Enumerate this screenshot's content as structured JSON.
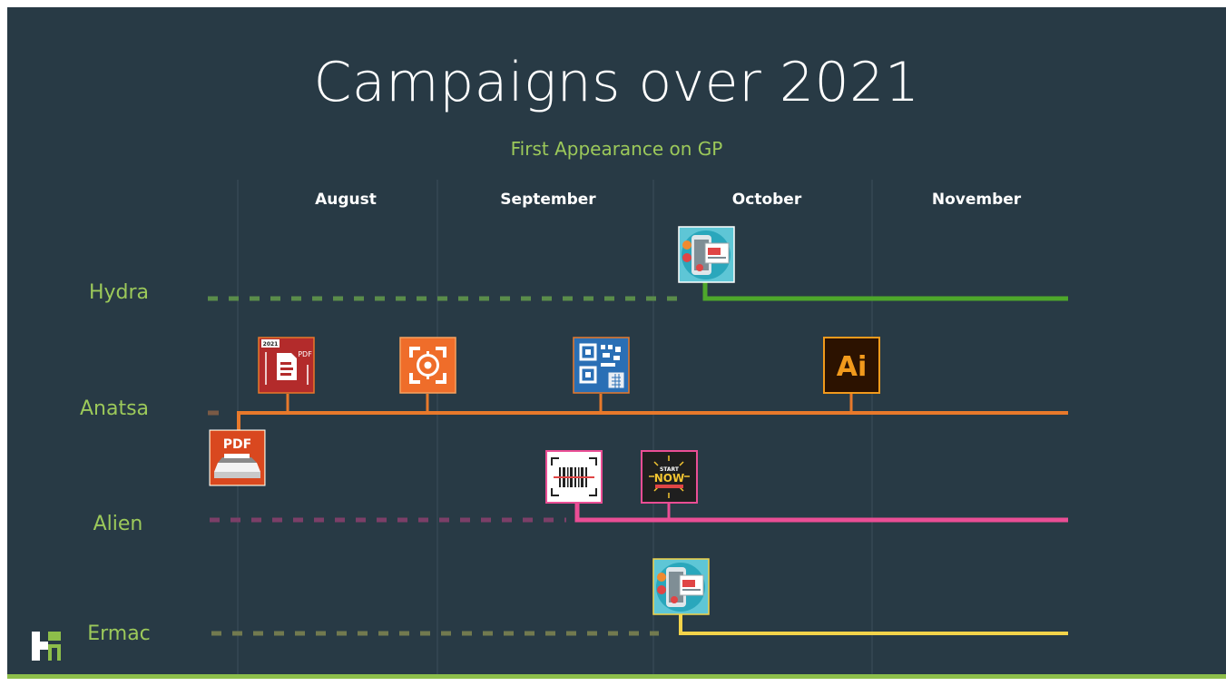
{
  "title": "Campaigns over 2021",
  "subtitle": "First Appearance on GP",
  "months": [
    "August",
    "September",
    "October",
    "November"
  ],
  "colors": {
    "background": "#283a45",
    "hydra": "#4ea72b",
    "anatsa": "#e8792b",
    "alien": "#ea4e95",
    "ermac": "#f3d34a",
    "label": "#9cc95a",
    "accent_bar": "#8dbe4a"
  },
  "rows": [
    {
      "name": "Hydra",
      "color": "#4ea72b",
      "dash_color": "#5a8c4a",
      "icons": [
        {
          "name": "phone-app-icon",
          "style": "phone",
          "line_end": "dashed"
        }
      ]
    },
    {
      "name": "Anatsa",
      "color": "#e8792b",
      "dash_color": "#7a5a45",
      "icons": [
        {
          "name": "pdf-scanner-icon",
          "style": "pdf-scanner",
          "position": "below"
        },
        {
          "name": "pdf-document-icon",
          "style": "pdf-doc",
          "badge": "2021",
          "text": "PDF",
          "position": "above"
        },
        {
          "name": "camera-scanner-icon",
          "style": "scan-target",
          "position": "above"
        },
        {
          "name": "qr-code-scanner-icon",
          "style": "qr",
          "position": "above"
        },
        {
          "name": "adobe-illustrator-icon",
          "style": "ai",
          "text": "Ai",
          "position": "above"
        }
      ]
    },
    {
      "name": "Alien",
      "color": "#ea4e95",
      "dash_color": "#7c3f68",
      "icons": [
        {
          "name": "barcode-scanner-icon",
          "style": "barcode",
          "position": "above"
        },
        {
          "name": "start-now-app-icon",
          "style": "start-now",
          "text": "NOW",
          "position": "above"
        }
      ]
    },
    {
      "name": "Ermac",
      "color": "#f3d34a",
      "dash_color": "#727a4f",
      "icons": [
        {
          "name": "phone-app-icon",
          "style": "phone",
          "position": "above"
        }
      ]
    }
  ],
  "pdf_label": "PDF",
  "ai_label": "Ai"
}
